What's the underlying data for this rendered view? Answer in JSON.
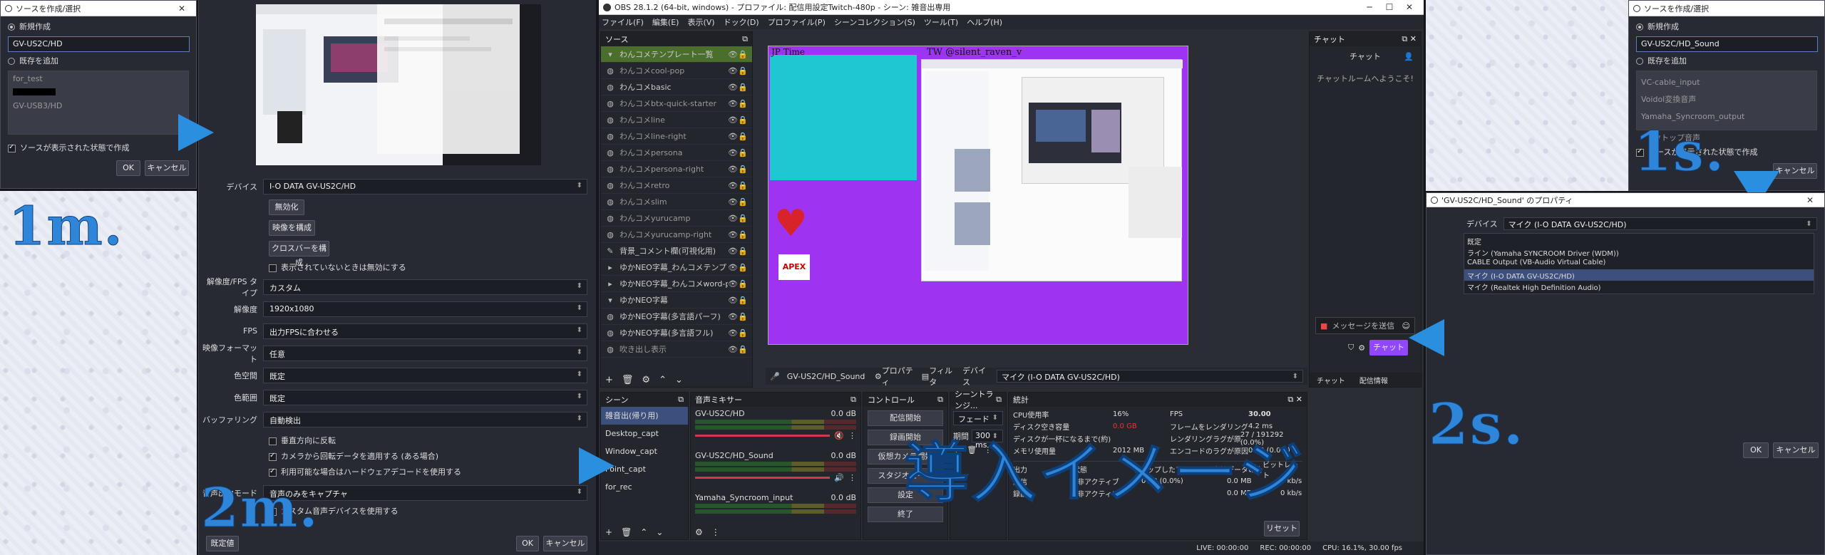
{
  "left_dialog": {
    "title": "ソースを作成/選択",
    "close": "✕",
    "create_new": "新規作成",
    "name_value": "GV-US2C/HD",
    "add_existing": "既存を追加",
    "existing": [
      "for_test",
      "GV-USB3/HD"
    ],
    "visible_check": "ソースが表示された状態で作成",
    "ok": "OK",
    "cancel": "キャンセル"
  },
  "left_caption": "1m.",
  "props_video": {
    "device_label": "デバイス",
    "device_value": "I-O DATA GV-US2C/HD",
    "btn_disable": "無効化",
    "btn_config_video": "映像を構成",
    "btn_crossbar": "クロスバーを構成",
    "chk_deactivate": "表示されていないときは無効にする",
    "rows": [
      {
        "label": "解像度/FPS タイプ",
        "value": "カスタム"
      },
      {
        "label": "解像度",
        "value": "1920x1080"
      },
      {
        "label": "FPS",
        "value": "出力FPSに合わせる"
      },
      {
        "label": "映像フォーマット",
        "value": "任意"
      },
      {
        "label": "色空間",
        "value": "既定"
      },
      {
        "label": "色範囲",
        "value": "既定"
      },
      {
        "label": "バッファリング",
        "value": "自動検出"
      }
    ],
    "chk_flip": "垂直方向に反転",
    "chk_rotation": "カメラから回転データを適用する (ある場合)",
    "chk_hw": "利用可能な場合はハードウェアデコードを使用する",
    "audio_out_label": "音声出力モード",
    "audio_out_value": "音声のみをキャプチャ",
    "chk_custom_audio": "カスタム音声デバイスを使用する",
    "defaults": "既定値",
    "ok": "OK",
    "cancel": "キャンセル"
  },
  "mid_caption": "2m.",
  "obs": {
    "title": "OBS 28.1.2 (64-bit, windows) - プロファイル: 配信用設定Twitch-480p - シーン: 雑音出専用",
    "menu": [
      "ファイル(F)",
      "編集(E)",
      "表示(V)",
      "ドック(D)",
      "プロファイル(P)",
      "シーンコレクション(S)",
      "ツール(T)",
      "ヘルプ(H)"
    ],
    "sources_title": "ソース",
    "sources": [
      "わんコメテンプレート一覧",
      "わんコメcool-pop",
      "わんコメbasic",
      "わんコメbtx-quick-starter",
      "わんコメline",
      "わんコメline-right",
      "わんコメpersona",
      "わんコメpersona-right",
      "わんコメretro",
      "わんコメslim",
      "わんコメyurucamp",
      "わんコメyurucamp-right",
      "背景_コメント欄(可視化用)",
      "ゆかNEO字幕_わんコメテンプレ",
      "ゆかNEO字幕_わんコメword-pa",
      "ゆかNEO字幕",
      "ゆかNEO字幕(多言語パーフ)",
      "ゆかNEO字幕(多言語フル)",
      "吹き出し表示"
    ],
    "preview_jp": "JP Time",
    "preview_tw": "TW @silent_raven_v",
    "preview_apex": "APEX",
    "chat_title": "チャット",
    "chat_header": "チャット",
    "chat_welcome": "チャットルームへようこそ!",
    "chat_send": "メッセージを送信",
    "chat_btn": "チャット",
    "tab_chat": "チャット",
    "tab_info": "配信情報",
    "srcbar_name": "GV-US2C/HD_Sound",
    "srcbar_props": "プロパティ",
    "srcbar_filter": "フィルタ",
    "srcbar_dev_label": "デバイス",
    "srcbar_dev_value": "マイク (I-O DATA GV-US2C/HD)",
    "scenes_title": "シーン",
    "scenes": [
      "雑音出(帰り用)",
      "Desktop_capt",
      "Window_capt",
      "Point_capt",
      "for_rec"
    ],
    "mixer_title": "音声ミキサー",
    "mixer": [
      {
        "name": "GV-US2C/HD",
        "db": "0.0 dB"
      },
      {
        "name": "GV-US2C/HD_Sound",
        "db": "0.0 dB"
      },
      {
        "name": "Yamaha_Syncroom_input",
        "db": "0.0 dB"
      }
    ],
    "controls_title": "コントロール",
    "controls": [
      "配信開始",
      "録画開始",
      "仮想カメラ開始",
      "スタジオモード",
      "設定",
      "終了"
    ],
    "trans_title": "シーントランジ...",
    "trans_value": "フェード",
    "trans_dur_label": "期間",
    "trans_dur": "300 ms",
    "stats_title": "統計",
    "stats_left": [
      {
        "k": "CPU使用率",
        "v": "16%"
      },
      {
        "k": "ディスク空き容量",
        "v": "0.0 GB"
      },
      {
        "k": "ディスクが一杯になるまで(約)",
        "v": ""
      },
      {
        "k": "メモリ使用量",
        "v": "2012 MB"
      }
    ],
    "stats_right": [
      {
        "k": "FPS",
        "v": "30.00"
      },
      {
        "k": "フレームをレンダリングする平均時間",
        "v": "4.2 ms"
      },
      {
        "k": "レンダリングラグが原因で逃したフレーム",
        "v": "27 / 191292 (0.0%)"
      },
      {
        "k": "エンコードのラグが原因でスキップされたフレーム",
        "v": "0 / 0 (0.0%)"
      }
    ],
    "out_headers": [
      "出力",
      "状態",
      "ドロップしたフレーム(ネットワーク)",
      "合計データの合計",
      "ビットレート"
    ],
    "out_rows": [
      [
        "配信",
        "非アクティブ",
        "0 / 0 (0.0%)",
        "0.0 MB",
        "0 kb/s"
      ],
      [
        "録画",
        "非アクティブ",
        "",
        "0.0 MB",
        "0 kb/s"
      ]
    ],
    "reset": "リセット",
    "status_live": "LIVE: 00:00:00",
    "status_rec": "REC: 00:00:00",
    "status_cpu": "CPU: 16.1%, 30.00 fps"
  },
  "overlay_caption": "導入イメージ",
  "right_dialog": {
    "title": "ソースを作成/選択",
    "create_new": "新規作成",
    "name_value": "GV-US2C/HD_Sound",
    "add_existing": "既存を追加",
    "existing": [
      "VC-cable_input",
      "Voidol変換音声",
      "Yamaha_Syncroom_output",
      "ウトップ音声"
    ],
    "visible_check": "ソースが表示された状態で作成",
    "cancel": "キャンセル"
  },
  "right_caption_1": "1s.",
  "audio_props": {
    "title": "'GV-US2C/HD_Sound' のプロパティ",
    "device_label": "デバイス",
    "device_value": "マイク (I-O DATA GV-US2C/HD)",
    "options": [
      "既定",
      "ライン (Yamaha SYNCROOM Driver (WDM))",
      "CABLE Output (VB-Audio Virtual Cable)",
      "マイク (I-O DATA GV-US2C/HD)",
      "マイク (Realtek High Definition Audio)"
    ],
    "selected_index": 3,
    "ok": "OK",
    "cancel": "キャンセル"
  },
  "right_caption_2": "2s."
}
